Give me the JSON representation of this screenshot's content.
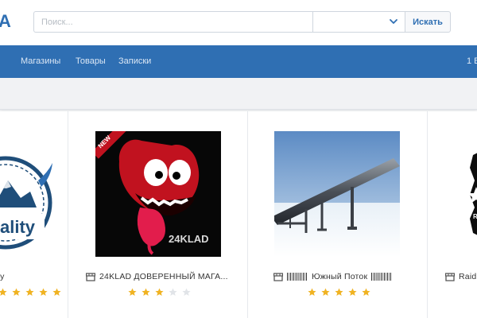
{
  "header": {
    "logo_text": "A",
    "search_placeholder": "Поиск...",
    "search_button": "Искать"
  },
  "nav": {
    "items": [
      "Магазины",
      "Товары",
      "Записки"
    ],
    "right_text": "1 В"
  },
  "products": [
    {
      "title": "ty",
      "rating": 5,
      "image": "quality-logo"
    },
    {
      "title": "24KLAD ДОВЕРЕННЫЙ МАГА...",
      "rating": 3,
      "badge": "NEW",
      "image_text": "24KLAD"
    },
    {
      "title": "Южный Поток",
      "rating": 5,
      "image": "pipeline-photo"
    },
    {
      "title": "Raid",
      "rating": 0,
      "image": "raid-logo"
    }
  ],
  "colors": {
    "brand": "#2f6fb3",
    "star": "#f0b323",
    "star_empty": "#e1e4e8"
  }
}
